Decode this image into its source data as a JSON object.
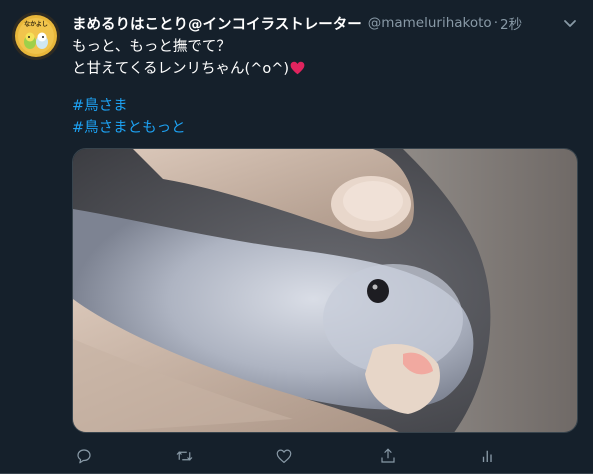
{
  "tweet": {
    "author": {
      "display_name": "まめるりはことり@インコイラストレーター",
      "handle": "@mamelurihakoto",
      "avatar_text": "なかよし"
    },
    "separator": "·",
    "time": "2秒",
    "text_lines": [
      "もっと、もっと撫でて？",
      "と甘えてくるレンリちゃん(^o^)"
    ],
    "hashtags": [
      "#鳥さま",
      "#鳥さまともっと"
    ],
    "media": {
      "kind": "photo"
    },
    "actions": [
      "reply-icon",
      "retweet-icon",
      "like-icon",
      "share-icon",
      "analytics-icon"
    ]
  },
  "colors": {
    "background": "#15202b",
    "text": "#ffffff",
    "secondary": "#8899a6",
    "link": "#1da1f2",
    "heart": "#e0245e",
    "border": "#38444d"
  }
}
